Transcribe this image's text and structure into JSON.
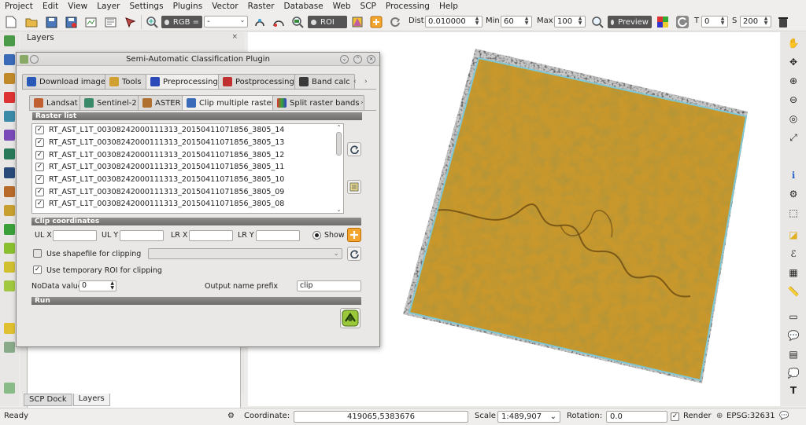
{
  "menu": [
    "Project",
    "Edit",
    "View",
    "Layer",
    "Settings",
    "Plugins",
    "Vector",
    "Raster",
    "Database",
    "Web",
    "SCP",
    "Processing",
    "Help"
  ],
  "toolbar": {
    "rgb_label": "RGB =",
    "rgb_value": "-",
    "roi_label": "ROI",
    "dist_label": "Dist",
    "dist_value": "0.010000",
    "min_label": "Min",
    "min_value": "60",
    "max_label": "Max",
    "max_value": "100",
    "preview_label": "Preview",
    "t_label": "T",
    "t_value": "0",
    "s_label": "S",
    "s_value": "200"
  },
  "layers_panel": {
    "title": "Layers",
    "close": "×"
  },
  "dock_tabs": [
    "SCP Dock",
    "Layers"
  ],
  "dialog": {
    "title": "Semi-Automatic Classification Plugin",
    "main_tabs": [
      "Download images",
      "Tools",
      "Preprocessing",
      "Postprocessing",
      "Band calc"
    ],
    "sub_tabs": [
      "Landsat",
      "Sentinel-2",
      "ASTER",
      "Clip multiple rasters",
      "Split raster bands"
    ],
    "raster_list_header": "Raster list",
    "raster_items": [
      "RT_AST_L1T_00308242000111313_20150411071856_3805_14",
      "RT_AST_L1T_00308242000111313_20150411071856_3805_13",
      "RT_AST_L1T_00308242000111313_20150411071856_3805_12",
      "RT_AST_L1T_00308242000111313_20150411071856_3805_11",
      "RT_AST_L1T_00308242000111313_20150411071856_3805_10",
      "RT_AST_L1T_00308242000111313_20150411071856_3805_09",
      "RT_AST_L1T_00308242000111313_20150411071856_3805_08"
    ],
    "clip_header": "Clip coordinates",
    "ulx": "UL X",
    "uly": "UL Y",
    "lrx": "LR X",
    "lry": "LR Y",
    "show": "Show",
    "use_shapefile": "Use shapefile for clipping",
    "use_roi": "Use temporary ROI for clipping",
    "nodata_label": "NoData value",
    "nodata_value": "0",
    "prefix_label": "Output name prefix",
    "prefix_value": "clip",
    "run_header": "Run"
  },
  "status": {
    "ready": "Ready",
    "coordinate_label": "Coordinate:",
    "coordinate_value": "419065,5383676",
    "scale_label": "Scale",
    "scale_value": "1:489,907",
    "rotation_label": "Rotation:",
    "rotation_value": "0.0",
    "render_label": "Render",
    "crs": "EPSG:32631"
  },
  "colors": {
    "raster": "#c9982c",
    "raster_border": "#7fc8d6",
    "accent": "#f0a030"
  }
}
